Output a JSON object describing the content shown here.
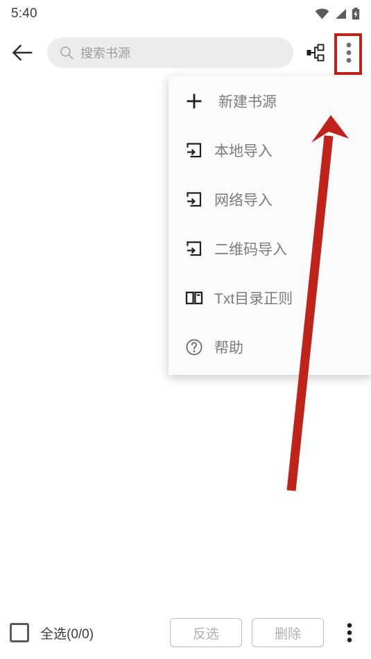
{
  "status_bar": {
    "time": "5:40",
    "icons": [
      "wifi-icon",
      "cellular-signal-icon",
      "battery-charging-icon"
    ]
  },
  "app_bar": {
    "back_icon": "back-arrow-icon",
    "search": {
      "placeholder": "搜索书源",
      "value": "",
      "icon": "search-icon"
    },
    "group_icon": "source-group-icon",
    "overflow_icon": "overflow-menu-icon"
  },
  "dropdown_menu": {
    "items": [
      {
        "label": "新建书源",
        "icon": "plus-icon"
      },
      {
        "label": "本地导入",
        "icon": "import-icon"
      },
      {
        "label": "网络导入",
        "icon": "import-icon"
      },
      {
        "label": "二维码导入",
        "icon": "import-icon"
      },
      {
        "label": "Txt目录正则",
        "icon": "open-book-icon"
      },
      {
        "label": "帮助",
        "icon": "help-circle-icon"
      }
    ]
  },
  "bottom_bar": {
    "select_all_label": "全选(0/0)",
    "select_all_checked": false,
    "invert_label": "反选",
    "delete_label": "删除",
    "overflow_icon": "overflow-menu-icon"
  },
  "annotation": {
    "highlight_color": "#c0231a",
    "arrow_color": "#c0231a",
    "target": "overflow-menu-icon"
  }
}
